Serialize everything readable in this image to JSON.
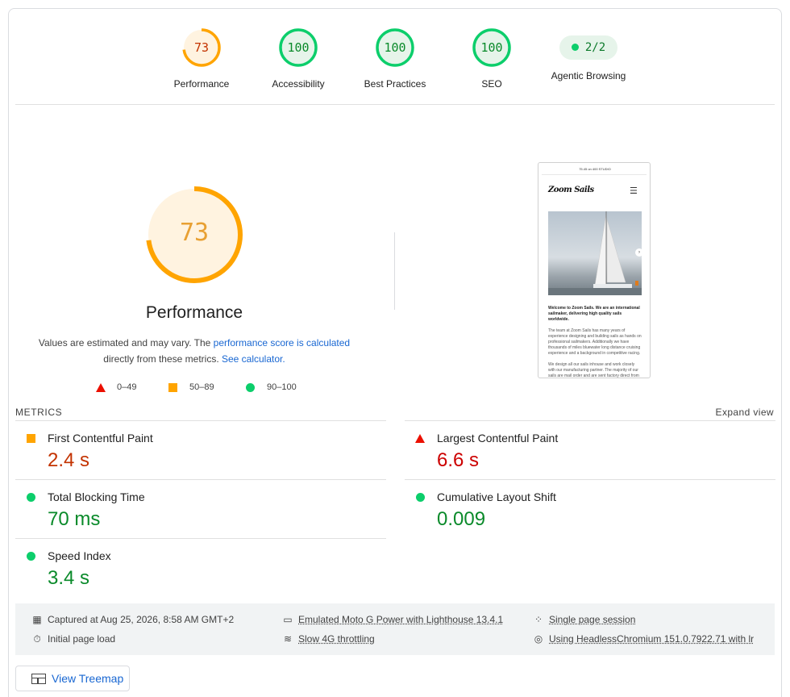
{
  "categories": [
    {
      "label": "Performance",
      "score": "73",
      "value": 0.73,
      "color": "#ffa400",
      "text_color": "#c33300",
      "bg": "#fff3e0"
    },
    {
      "label": "Accessibility",
      "score": "100",
      "value": 1.0,
      "color": "#0cce6b",
      "text_color": "#0a8a2a",
      "bg": "#e6f4ea"
    },
    {
      "label": "Best Practices",
      "score": "100",
      "value": 1.0,
      "color": "#0cce6b",
      "text_color": "#0a8a2a",
      "bg": "#e6f4ea"
    },
    {
      "label": "SEO",
      "score": "100",
      "value": 1.0,
      "color": "#0cce6b",
      "text_color": "#0a8a2a",
      "bg": "#e6f4ea"
    },
    {
      "label": "Agentic Browsing",
      "score": "2/2",
      "color": "#0cce6b"
    }
  ],
  "performance": {
    "score": "73",
    "value": 0.73,
    "title": "Performance",
    "desc_prefix": "Values are estimated and may vary. The ",
    "desc_link": "performance score is calculated",
    "desc_middle": " directly from these metrics. ",
    "desc_link2": "See calculator.",
    "legend": {
      "poor": "0–49",
      "average": "50–89",
      "good": "90–100"
    }
  },
  "screenshot": {
    "topbar": "75.45 on 400 STUDIO",
    "logo": "Zoom Sails",
    "headline": "Welcome to Zoom Sails. We are an international sailmaker, delivering high quality sails worldwide.",
    "para1": "The team at Zoom Sails has many years of experience designing and building sails as hands on professional sailmakers. Additionally we have thousands of miles bluewater long distance cruising experience and a background in competitive racing.",
    "para2": "We design all our sails inhouse and work closely with our manufacturing partner. The majority of our sails are mail order and are sent factory direct from fr"
  },
  "metrics": {
    "heading": "METRICS",
    "expand": "Expand view",
    "items": [
      {
        "name": "First Contentful Paint",
        "value": "2.4 s",
        "rating": "average"
      },
      {
        "name": "Largest Contentful Paint",
        "value": "6.6 s",
        "rating": "poor"
      },
      {
        "name": "Total Blocking Time",
        "value": "70 ms",
        "rating": "good"
      },
      {
        "name": "Cumulative Layout Shift",
        "value": "0.009",
        "rating": "good"
      },
      {
        "name": "Speed Index",
        "value": "3.4 s",
        "rating": "good"
      }
    ]
  },
  "runtime": {
    "captured": "Captured at Aug 25, 2026, 8:58 AM GMT+2",
    "initial": "Initial page load",
    "device": "Emulated Moto G Power with Lighthouse 13.4.1",
    "throttling": "Slow 4G throttling",
    "session": "Single page session",
    "browser": "Using HeadlessChromium 151.0.7922.71 with lr"
  },
  "treemap_label": "View Treemap"
}
